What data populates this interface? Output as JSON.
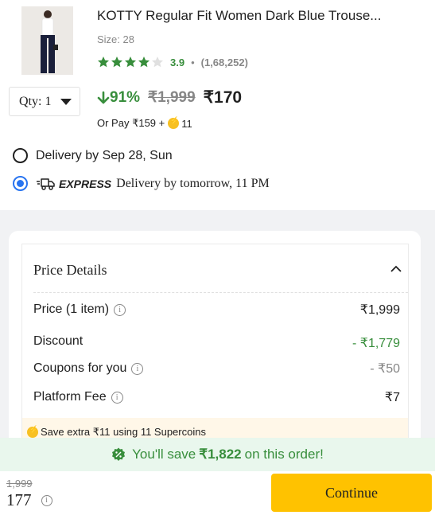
{
  "product": {
    "title": "KOTTY Regular Fit Women Dark Blue Trouse...",
    "size": "Size: 28",
    "rating_value": "3.9",
    "rating_stars": 3.9,
    "rating_separator": "•",
    "rating_count": "(1,68,252)",
    "qty_label": "Qty: 1",
    "discount": "91%",
    "mrp": "₹1,999",
    "price": "₹170",
    "or_pay_text": "Or Pay ₹159 +",
    "or_pay_coins": "11"
  },
  "delivery": {
    "option1": "Delivery by Sep 28, Sun",
    "express_label": "EXPRESS",
    "option2": "Delivery by tomorrow, 11 PM"
  },
  "price_details": {
    "title": "Price Details",
    "rows": [
      {
        "label": "Price (1 item)",
        "value": "₹1,999"
      },
      {
        "label": "Discount",
        "value": "- ₹1,779"
      },
      {
        "label": "Coupons for you",
        "value": "- ₹50"
      },
      {
        "label": "Platform Fee",
        "value": "₹7"
      }
    ],
    "supercoins_text": "Save extra ₹11 using 11 Supercoins"
  },
  "savings": {
    "prefix": "You'll save",
    "amount": "₹1,822",
    "suffix": "on this order!"
  },
  "footer": {
    "mrp": "1,999",
    "price": "177",
    "continue_label": "Continue"
  },
  "colors": {
    "green": "#388e3c",
    "blue": "#2874f0",
    "continue_yellow": "#ffc200",
    "coin_yellow": "#f7c022"
  }
}
